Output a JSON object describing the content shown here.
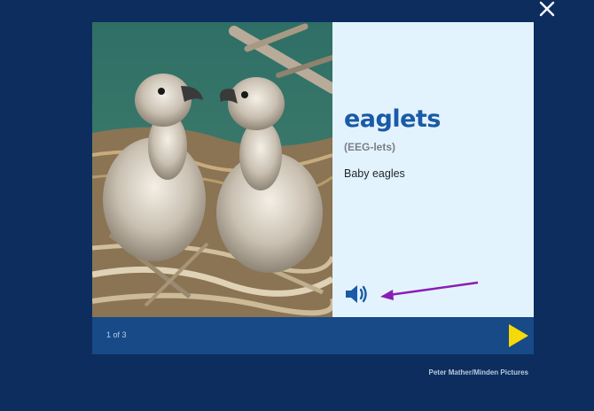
{
  "close_icon": "close-icon",
  "card": {
    "word": "eaglets",
    "pronunciation": "(EEG-lets)",
    "definition": "Baby eagles",
    "audio_icon": "speaker-icon"
  },
  "footer": {
    "page_count": "1 of 3",
    "next_icon": "play-triangle-icon"
  },
  "photo_credit": "Peter Mather/Minden Pictures",
  "colors": {
    "background": "#0d2d5e",
    "card": "#e3f3fd",
    "footer": "#174a86",
    "word": "#1a5aa6",
    "next": "#f5d90a",
    "annotation_arrow": "#8a1db5"
  }
}
